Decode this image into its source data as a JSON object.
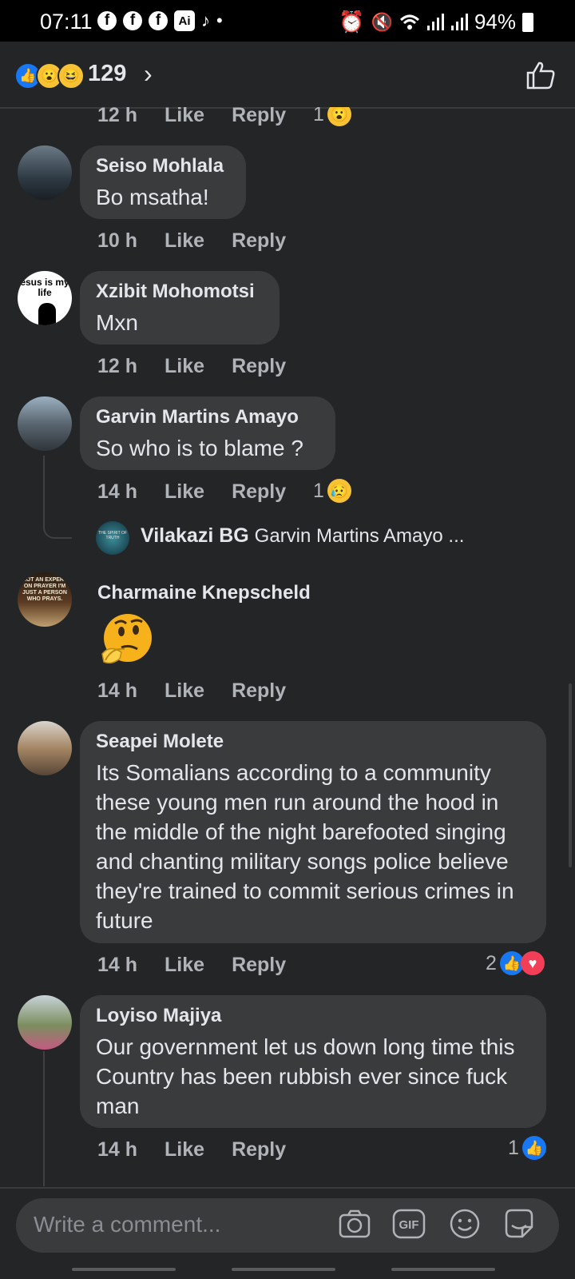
{
  "status_bar": {
    "time": "07:11",
    "battery": "94%"
  },
  "header": {
    "reaction_count": "129"
  },
  "action_labels": {
    "like": "Like",
    "reply": "Reply"
  },
  "comments": [
    {
      "time": "12 h",
      "reaction_count": "1"
    },
    {
      "name": "Seiso Mohlala",
      "text": "Bo msatha!",
      "time": "10 h"
    },
    {
      "name": "Xzibit Mohomotsi",
      "text": "Mxn",
      "time": "12 h",
      "avatar_text": "esus is my life"
    },
    {
      "name": "Garvin Martins Amayo",
      "text": "So who is to blame ?",
      "time": "14 h",
      "reaction_count": "1"
    },
    {
      "name": "Charmaine Knepscheld",
      "time": "14 h",
      "avatar_text": "NOT AN EXPERT ON PRAYER I'M JUST A PERSON WHO PRAYS."
    },
    {
      "name": "Seapei Molete",
      "text": "Its Somalians according to a community these young men run around the hood in the middle of the night barefooted singing and chanting military songs police believe they're trained to commit serious crimes in future",
      "time": "14 h",
      "reaction_count": "2"
    },
    {
      "name": "Loyiso Majiya",
      "text": "Our government let us down long time this Country has been rubbish ever since fuck    man",
      "time": "14 h",
      "reaction_count": "1"
    }
  ],
  "reply_preview": {
    "name": "Vilakazi BG",
    "snippet": "Garvin Martins Amayo ...",
    "avatar_text": "THE SPIRIT OF TRUTH"
  },
  "composer": {
    "placeholder": "Write a comment..."
  },
  "colors": {
    "background": "#242526",
    "bubble": "#3a3b3c",
    "like_blue": "#1877f2",
    "love_red": "#f33e58"
  }
}
